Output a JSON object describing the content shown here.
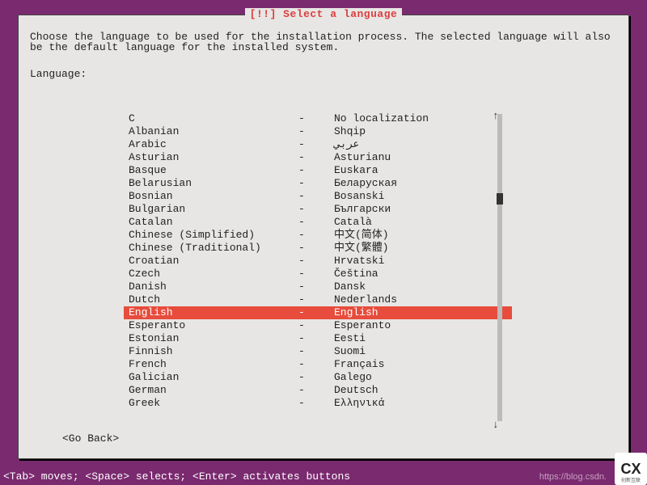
{
  "title": "[!!] Select a language",
  "instructions": "Choose the language to be used for the installation process. The selected language will also be the default language for the installed system.",
  "field_label": "Language:",
  "separator": "-",
  "scroll": {
    "up": "↑",
    "down": "↓"
  },
  "languages": [
    {
      "name": "C",
      "native": "No localization",
      "selected": false
    },
    {
      "name": "Albanian",
      "native": "Shqip",
      "selected": false
    },
    {
      "name": "Arabic",
      "native": "عربي",
      "selected": false
    },
    {
      "name": "Asturian",
      "native": "Asturianu",
      "selected": false
    },
    {
      "name": "Basque",
      "native": "Euskara",
      "selected": false
    },
    {
      "name": "Belarusian",
      "native": "Беларуская",
      "selected": false
    },
    {
      "name": "Bosnian",
      "native": "Bosanski",
      "selected": false
    },
    {
      "name": "Bulgarian",
      "native": "Български",
      "selected": false
    },
    {
      "name": "Catalan",
      "native": "Català",
      "selected": false
    },
    {
      "name": "Chinese (Simplified)",
      "native": "中文(简体)",
      "selected": false
    },
    {
      "name": "Chinese (Traditional)",
      "native": "中文(繁體)",
      "selected": false
    },
    {
      "name": "Croatian",
      "native": "Hrvatski",
      "selected": false
    },
    {
      "name": "Czech",
      "native": "Čeština",
      "selected": false
    },
    {
      "name": "Danish",
      "native": "Dansk",
      "selected": false
    },
    {
      "name": "Dutch",
      "native": "Nederlands",
      "selected": false
    },
    {
      "name": "English",
      "native": "English",
      "selected": true
    },
    {
      "name": "Esperanto",
      "native": "Esperanto",
      "selected": false
    },
    {
      "name": "Estonian",
      "native": "Eesti",
      "selected": false
    },
    {
      "name": "Finnish",
      "native": "Suomi",
      "selected": false
    },
    {
      "name": "French",
      "native": "Français",
      "selected": false
    },
    {
      "name": "Galician",
      "native": "Galego",
      "selected": false
    },
    {
      "name": "German",
      "native": "Deutsch",
      "selected": false
    },
    {
      "name": "Greek",
      "native": "Ελληνικά",
      "selected": false
    }
  ],
  "go_back": "<Go Back>",
  "footer_hint": "<Tab> moves; <Space> selects; <Enter> activates buttons",
  "watermark": "https://blog.csdn.",
  "logo": {
    "main": "CX",
    "sub": "创新互联"
  }
}
